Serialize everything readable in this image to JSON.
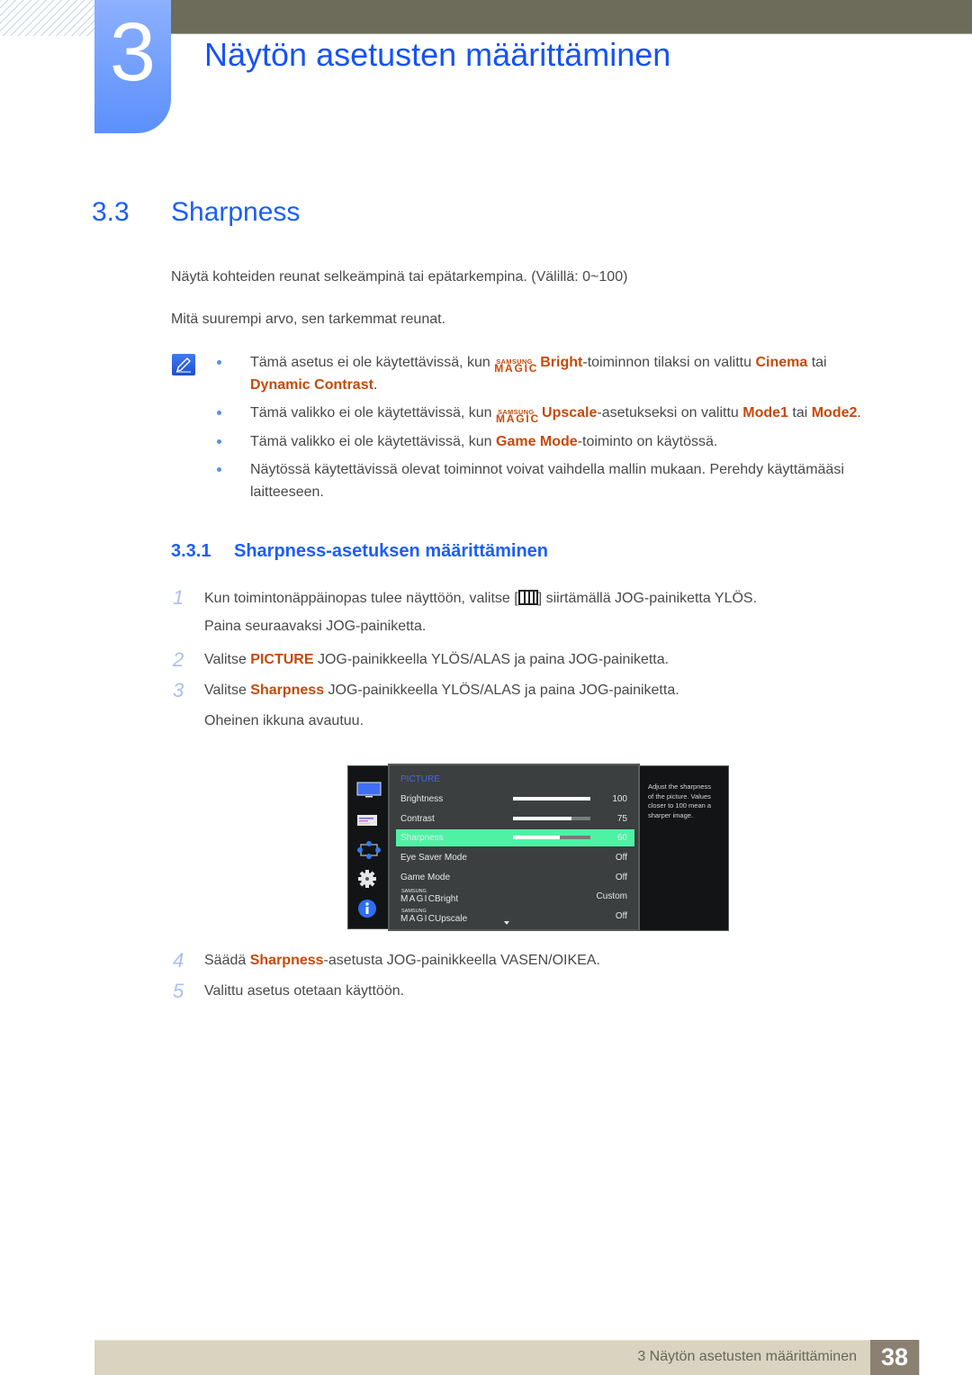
{
  "header": {
    "chapter_number": "3",
    "chapter_title": "Näytön asetusten määrittäminen"
  },
  "section": {
    "number": "3.3",
    "title": "Sharpness"
  },
  "intro": {
    "line1": "Näytä kohteiden reunat selkeämpinä tai epätarkempina. (Välillä: 0~100)",
    "line2": "Mitä suurempi arvo, sen tarkemmat reunat."
  },
  "magic_logo": {
    "top": "SAMSUNG",
    "bottom": "MAGIC"
  },
  "notes": [
    {
      "pre": "Tämä asetus ei ole käytettävissä, kun ",
      "magic_term": "Bright",
      "mid": "-toiminnon tilaksi on valittu ",
      "hl1": "Cinema",
      "mid2": " tai",
      "hl2": "Dynamic Contrast",
      "post": "."
    },
    {
      "pre": "Tämä valikko ei ole käytettävissä, kun ",
      "magic_term": "Upscale",
      "mid": "-asetukseksi on valittu ",
      "hl1": "Mode1",
      "mid2": " tai ",
      "hl2": "Mode2",
      "post": "."
    },
    {
      "pre": "Tämä valikko ei ole käytettävissä, kun ",
      "hl1": "Game Mode",
      "post": "-toiminto on käytössä."
    },
    {
      "line1": "Näytössä käytettävissä olevat toiminnot voivat vaihdella mallin mukaan. Perehdy käyttämääsi",
      "line2": "laitteeseen."
    }
  ],
  "subsection": {
    "number": "3.3.1",
    "title": "Sharpness-asetuksen määrittäminen"
  },
  "steps": [
    {
      "num": "1",
      "pre": "Kun toimintonäppäinopas tulee näyttöön, valitse [",
      "post": "] siirtämällä JOG-painiketta YLÖS.",
      "line2": "Paina seuraavaksi JOG-painiketta."
    },
    {
      "num": "2",
      "pre": "Valitse ",
      "hl": "PICTURE",
      "post": " JOG-painikkeella YLÖS/ALAS ja paina JOG-painiketta."
    },
    {
      "num": "3",
      "pre": "Valitse ",
      "hl": "Sharpness",
      "post": " JOG-painikkeella YLÖS/ALAS ja paina JOG-painiketta.",
      "line2": "Oheinen ikkuna avautuu."
    },
    {
      "num": "4",
      "pre": "Säädä ",
      "hl": "Sharpness",
      "post": "-asetusta JOG-painikkeella VASEN/OIKEA."
    },
    {
      "num": "5",
      "pre": "Valittu asetus otetaan käyttöön."
    }
  ],
  "osd": {
    "category": "PICTURE",
    "sidebar_icons": [
      "monitor-icon",
      "picture-settings-icon",
      "size-position-icon",
      "gear-icon",
      "info-icon"
    ],
    "items": [
      {
        "label": "Brightness",
        "value": "100",
        "level": 100
      },
      {
        "label": "Contrast",
        "value": "75",
        "level": 75
      },
      {
        "label": "Sharpness",
        "value": "60",
        "level": 60,
        "selected": true
      },
      {
        "label": "Eye Saver Mode",
        "value": "Off"
      },
      {
        "label": "Game Mode",
        "value": "Off"
      },
      {
        "label": "Bright",
        "magic": true,
        "value": "Custom"
      },
      {
        "label": "Upscale",
        "magic": true,
        "value": "Off"
      }
    ],
    "help_text_lines": [
      "Adjust the sharpness",
      "of the picture. Values",
      "closer to 100 mean a",
      "sharper image."
    ],
    "colors": {
      "selected": "#4ef2a5",
      "category": "#4a64e8"
    }
  },
  "footer": {
    "chapter_ref": "3 Näytön asetusten määrittäminen",
    "page_number": "38"
  }
}
